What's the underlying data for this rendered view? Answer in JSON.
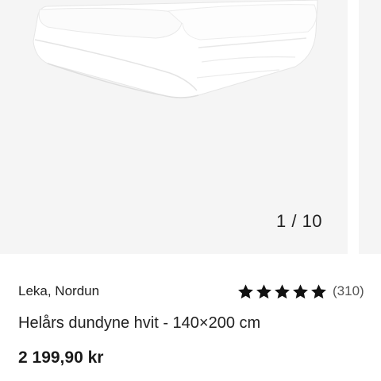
{
  "gallery": {
    "counter": "1 / 10"
  },
  "product": {
    "brand": "Leka, Nordun",
    "title": "Helårs dundyne hvit - 140×200 cm",
    "price": "2 199,90 kr",
    "rating": {
      "stars": 5,
      "max": 5,
      "review_count": "(310)"
    }
  },
  "colors": {
    "slide_background": "#f5f5f5",
    "star": "#111111",
    "text": "#222222"
  },
  "icons": {
    "star": "star-icon"
  }
}
